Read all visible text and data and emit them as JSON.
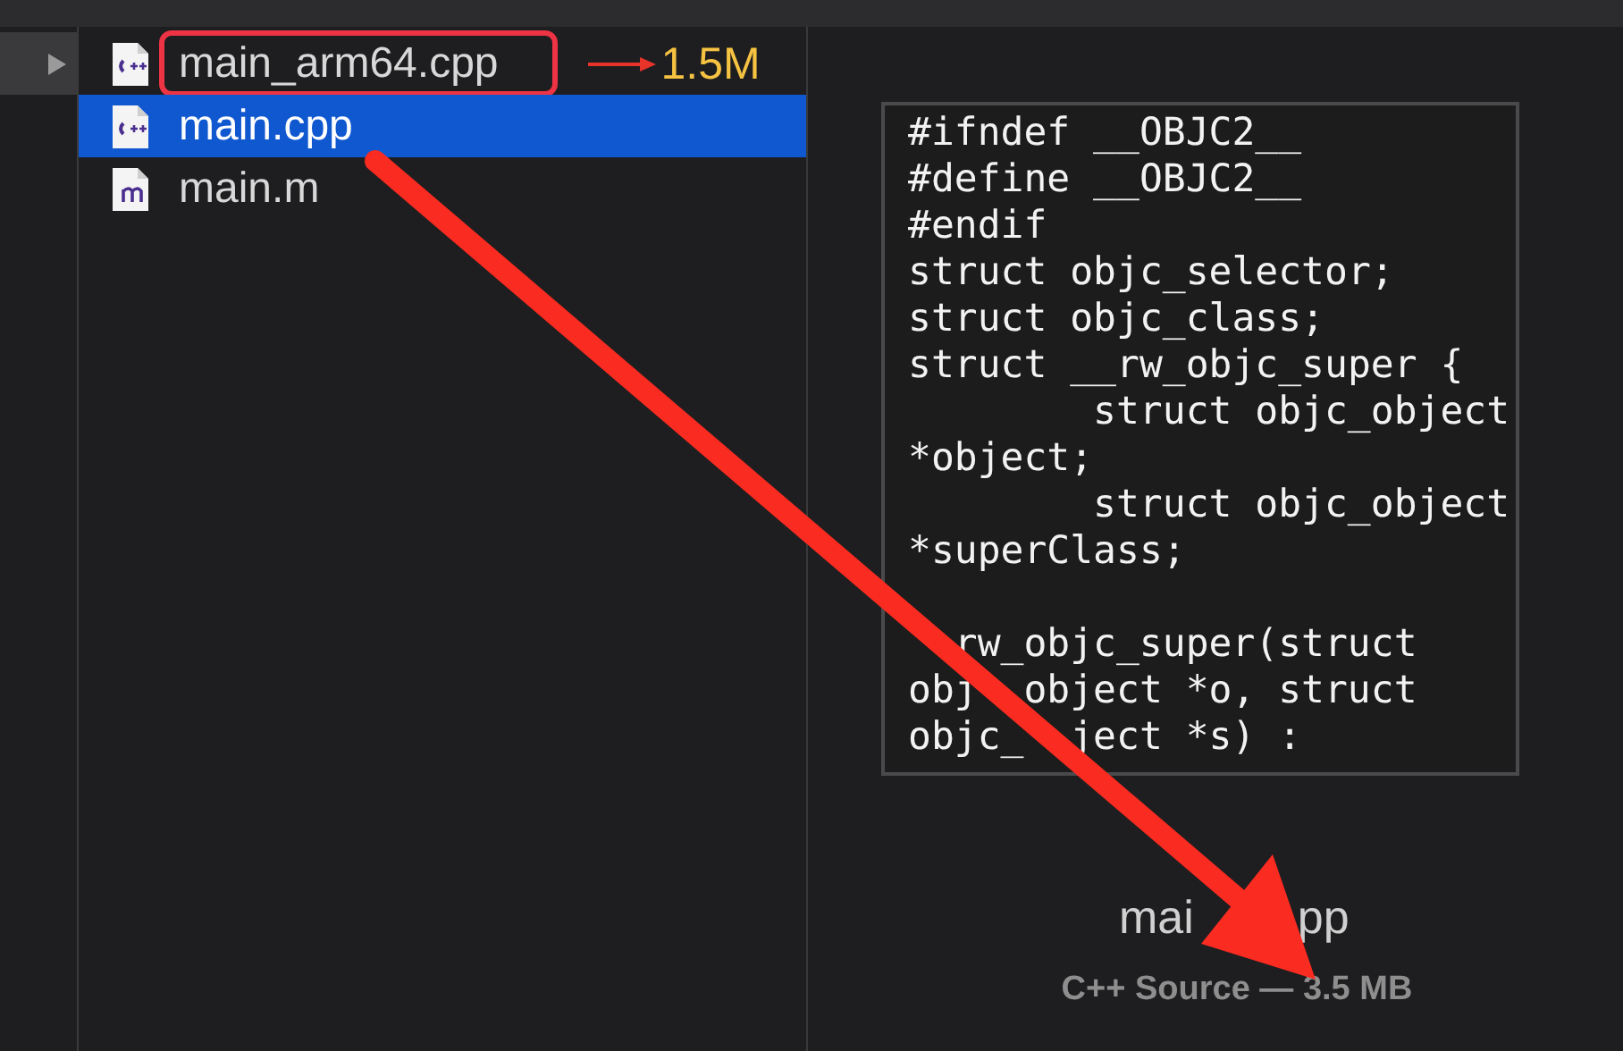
{
  "files": [
    {
      "name": "main_arm64.cpp",
      "kind": "cpp",
      "selected": false,
      "circled": true,
      "note": "1.5M"
    },
    {
      "name": "main.cpp",
      "kind": "cpp",
      "selected": true,
      "circled": false
    },
    {
      "name": "main.m",
      "kind": "m",
      "selected": false,
      "circled": false
    }
  ],
  "preview": {
    "code_blocks": [
      [
        "#ifndef __OBJC2__",
        "#define __OBJC2__",
        "#endif",
        "struct objc_selector;",
        "struct objc_class;",
        "struct __rw_objc_super {",
        "        struct objc_object",
        "*object;",
        "        struct objc_object",
        "*superClass;"
      ],
      [
        [
          "  rw_objc_super(struct"
        ],
        [
          "obj",
          "  object *o, struct"
        ],
        [
          "objc_",
          "  ject *s) :"
        ]
      ]
    ],
    "file_name_parts": [
      "mai",
      "pp"
    ],
    "file_info": "C++ Source — 3.5 MB"
  }
}
